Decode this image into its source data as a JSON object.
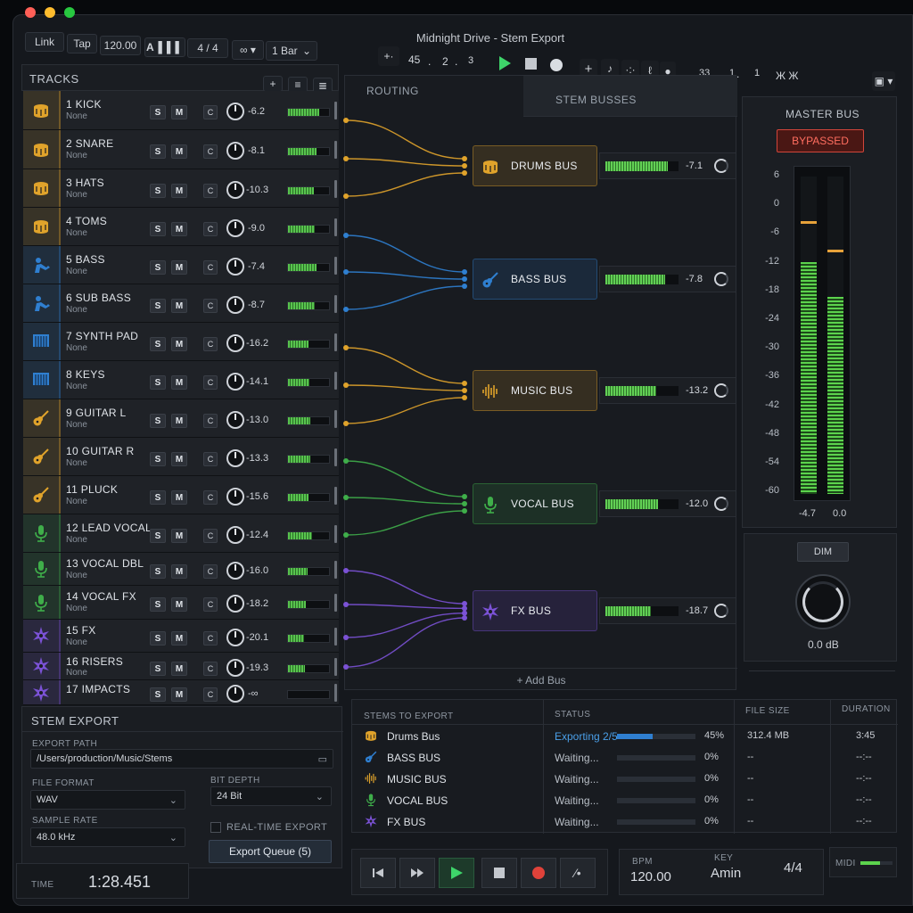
{
  "window": {
    "title": "Midnight Drive - Stem Export",
    "traffic_colors": [
      "#ff5f57",
      "#febc2e",
      "#28c840"
    ]
  },
  "toolbar": {
    "link": "Link",
    "tap": "Tap",
    "tempo": "120.00",
    "signature": "4 / 4",
    "quantize": "1 Bar",
    "position": [
      "45",
      "2",
      "3"
    ],
    "loop_position": [
      "33",
      "1",
      "1"
    ]
  },
  "tracks": {
    "header": "TRACKS",
    "solo": "S",
    "mute": "M",
    "items": [
      {
        "name": "1 KICK",
        "route": "None",
        "value": "-6.2",
        "level": 0.75,
        "color": "#e0a32b",
        "icon": "drum-icon"
      },
      {
        "name": "2 SNARE",
        "route": "None",
        "value": "-8.1",
        "level": 0.7,
        "color": "#e0a32b",
        "icon": "drum-icon"
      },
      {
        "name": "3 HATS",
        "route": "None",
        "value": "-10.3",
        "level": 0.62,
        "color": "#e0a32b",
        "icon": "drum-icon"
      },
      {
        "name": "4 TOMS",
        "route": "None",
        "value": "-9.0",
        "level": 0.65,
        "color": "#e0a32b",
        "icon": "drum-icon"
      },
      {
        "name": "5 BASS",
        "route": "None",
        "value": "-7.4",
        "level": 0.7,
        "color": "#2f7fd0",
        "icon": "bass-player-icon"
      },
      {
        "name": "6 SUB BASS",
        "route": "None",
        "value": "-8.7",
        "level": 0.66,
        "color": "#2f7fd0",
        "icon": "bass-player-icon"
      },
      {
        "name": "7 SYNTH PAD",
        "route": "None",
        "value": "-16.2",
        "level": 0.5,
        "color": "#2f7fd0",
        "icon": "keyboard-icon"
      },
      {
        "name": "8 KEYS",
        "route": "None",
        "value": "-14.1",
        "level": 0.52,
        "color": "#2f7fd0",
        "icon": "keyboard-icon"
      },
      {
        "name": "9 GUITAR L",
        "route": "None",
        "value": "-13.0",
        "level": 0.55,
        "color": "#e0a32b",
        "icon": "guitar-icon"
      },
      {
        "name": "10 GUITAR R",
        "route": "None",
        "value": "-13.3",
        "level": 0.55,
        "color": "#e0a32b",
        "icon": "guitar-icon"
      },
      {
        "name": "11 PLUCK",
        "route": "None",
        "value": "-15.6",
        "level": 0.5,
        "color": "#e0a32b",
        "icon": "guitar-icon"
      },
      {
        "name": "12 LEAD VOCAL",
        "route": "None",
        "value": "-12.4",
        "level": 0.58,
        "color": "#3fae4a",
        "icon": "microphone-icon"
      },
      {
        "name": "13 VOCAL DBL",
        "route": "None",
        "value": "-16.0",
        "level": 0.48,
        "color": "#3fae4a",
        "icon": "microphone-icon"
      },
      {
        "name": "14 VOCAL FX",
        "route": "None",
        "value": "-18.2",
        "level": 0.44,
        "color": "#3fae4a",
        "icon": "microphone-icon"
      },
      {
        "name": "15 FX",
        "route": "None",
        "value": "-20.1",
        "level": 0.4,
        "color": "#7b52d6",
        "icon": "sparkle-icon"
      },
      {
        "name": "16 RISERS",
        "route": "None",
        "value": "-19.3",
        "level": 0.42,
        "color": "#7b52d6",
        "icon": "sparkle-icon"
      },
      {
        "name": "17 IMPACTS",
        "route": "",
        "value": "-∞",
        "level": 0.0,
        "color": "#7b52d6",
        "icon": "sparkle-icon"
      }
    ]
  },
  "routing": {
    "header": "ROUTING",
    "busses_header": "STEM BUSSES",
    "add_bus": "+ Add Bus",
    "busses": [
      {
        "name": "DRUMS BUS",
        "value": "-7.1",
        "level": 0.85,
        "color": "#e0a32b",
        "icon": "drum-icon"
      },
      {
        "name": "BASS BUS",
        "value": "-7.8",
        "level": 0.82,
        "color": "#2f7fd0",
        "icon": "guitar-icon"
      },
      {
        "name": "MUSIC BUS",
        "value": "-13.2",
        "level": 0.7,
        "color": "#e0a32b",
        "icon": "waveform-icon"
      },
      {
        "name": "VOCAL BUS",
        "value": "-12.0",
        "level": 0.72,
        "color": "#3fae4a",
        "icon": "microphone-icon"
      },
      {
        "name": "FX BUS",
        "value": "-18.7",
        "level": 0.62,
        "color": "#7b52d6",
        "icon": "sparkle-icon"
      }
    ]
  },
  "master": {
    "header": "MASTER BUS",
    "bypassed": "BYPASSED",
    "scale": [
      "6",
      "0",
      "-6",
      "-12",
      "-18",
      "-24",
      "-30",
      "-36",
      "-42",
      "-48",
      "-54",
      "-60"
    ],
    "left_value": "-4.7",
    "right_value": "0.0",
    "left_level": 0.73,
    "right_level": 0.62,
    "dim": "DIM",
    "dim_value": "0.0 dB"
  },
  "stem_export": {
    "header": "STEM EXPORT",
    "export_path_label": "EXPORT PATH",
    "export_path": "/Users/production/Music/Stems",
    "file_format_label": "FILE FORMAT",
    "file_format": "WAV",
    "bit_depth_label": "BIT DEPTH",
    "bit_depth": "24 Bit",
    "sample_rate_label": "SAMPLE RATE",
    "sample_rate": "48.0 kHz",
    "realtime_label": "REAL-TIME EXPORT",
    "export_queue": "Export Queue (5)"
  },
  "queue": {
    "headers": [
      "STEMS TO EXPORT",
      "STATUS",
      "FILE SIZE",
      "DURATION"
    ],
    "rows": [
      {
        "name": "Drums Bus",
        "status": "Exporting 2/5",
        "percent": "45%",
        "progress": 0.45,
        "size": "312.4 MB",
        "duration": "3:45",
        "color": "#e0a32b",
        "icon": "drum-icon"
      },
      {
        "name": "BASS BUS",
        "status": "Waiting...",
        "percent": "0%",
        "progress": 0,
        "size": "--",
        "duration": "--:--",
        "color": "#2f7fd0",
        "icon": "guitar-icon"
      },
      {
        "name": "MUSIC BUS",
        "status": "Waiting...",
        "percent": "0%",
        "progress": 0,
        "size": "--",
        "duration": "--:--",
        "color": "#e0a32b",
        "icon": "waveform-icon"
      },
      {
        "name": "VOCAL BUS",
        "status": "Waiting...",
        "percent": "0%",
        "progress": 0,
        "size": "--",
        "duration": "--:--",
        "color": "#3fae4a",
        "icon": "microphone-icon"
      },
      {
        "name": "FX BUS",
        "status": "Waiting...",
        "percent": "0%",
        "progress": 0,
        "size": "--",
        "duration": "--:--",
        "color": "#7b52d6",
        "icon": "sparkle-icon"
      }
    ]
  },
  "footer": {
    "time_label": "TIME",
    "time": "1:28.451",
    "bpm_label": "BPM",
    "bpm": "120.00",
    "key_label": "KEY",
    "key": "Amin",
    "signature": "4/4",
    "midi_label": "MIDI"
  }
}
